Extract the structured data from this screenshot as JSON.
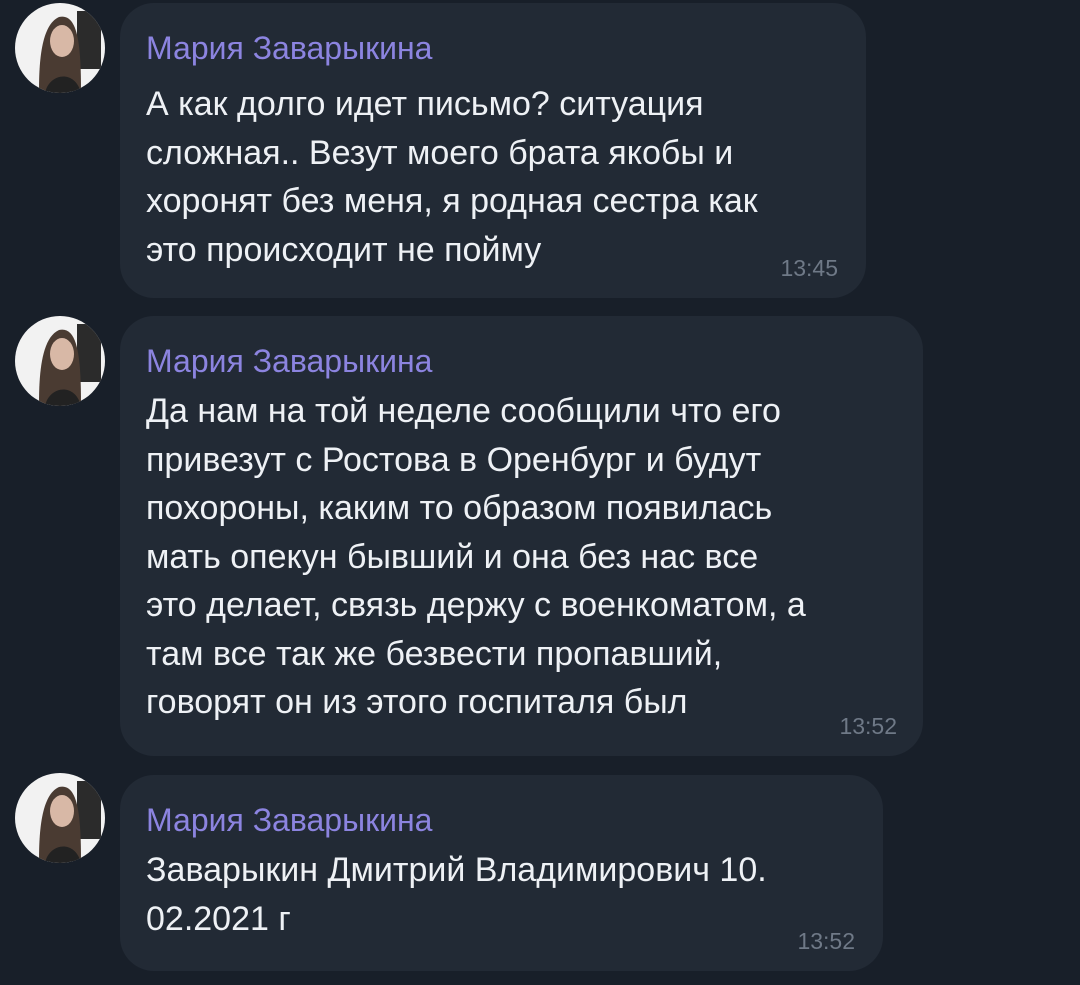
{
  "messages": [
    {
      "sender": "Мария Заварыкина",
      "lines": [
        "А как долго идет письмо? ситуация",
        "сложная.. Везут моего брата якобы  и",
        "хоронят без меня, я родная сестра как",
        "это происходит не пойму"
      ],
      "time": "13:45"
    },
    {
      "sender": "Мария Заварыкина",
      "lines": [
        "Да нам на той неделе сообщили что его",
        "привезут с Ростова в Оренбург и будут",
        "похороны, каким то образом появилась",
        "мать опекун бывший и она без нас все",
        "это делает, связь держу с военкоматом, а",
        "там все так же безвести пропавший,",
        "говорят он из этого госпиталя был"
      ],
      "time": "13:52"
    },
    {
      "sender": "Мария Заварыкина",
      "lines": [
        "Заварыкин Дмитрий Владимирович 10.",
        "02.2021 г"
      ],
      "time": "13:52"
    }
  ],
  "colors": {
    "background": "#181f29",
    "bubble": "#222a35",
    "sender": "#8c84e0",
    "text": "#eef1f5",
    "time": "#6f7987"
  },
  "icons": {
    "avatar": "user-photo-avatar"
  }
}
